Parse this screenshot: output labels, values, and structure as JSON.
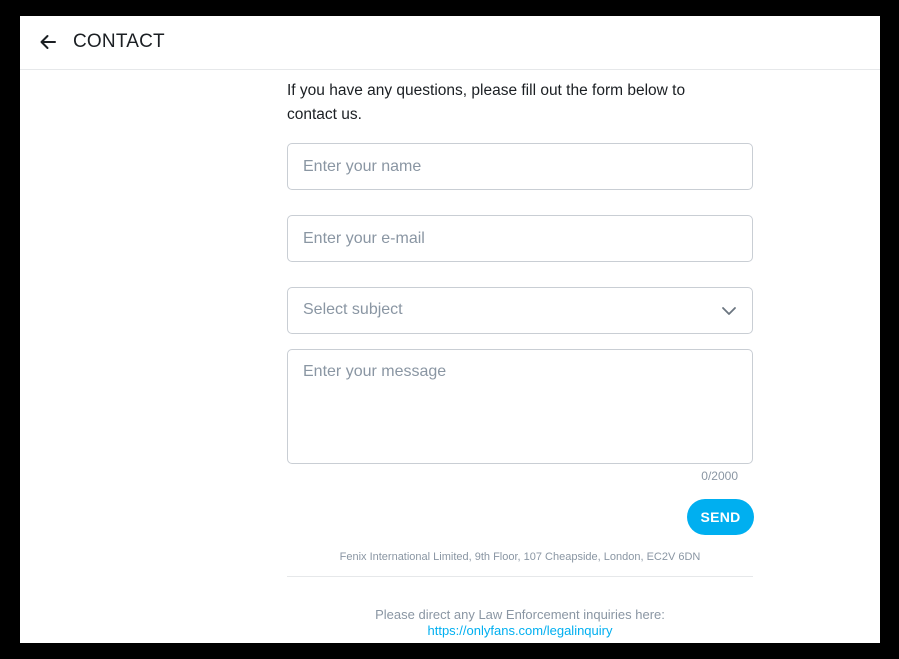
{
  "header": {
    "back_icon": "arrow-left-icon",
    "title": "CONTACT"
  },
  "intro": {
    "text": "If you have any questions, please fill out the form below to contact us."
  },
  "form": {
    "name_placeholder": "Enter your name",
    "email_placeholder": "Enter your e-mail",
    "subject_value": "Select subject",
    "subject_icon": "chevron-down-icon",
    "message_placeholder": "Enter your message",
    "message_counter": "0/2000",
    "send_label": "SEND"
  },
  "footer": {
    "address": "Fenix International Limited, 9th Floor, 107 Cheapside, London, EC2V 6DN",
    "law_text": "Please direct any Law Enforcement inquiries here:",
    "law_link": "https://onlyfans.com/legalinquiry"
  },
  "colors": {
    "accent": "#00aff0",
    "text": "#1b1f23",
    "muted": "#8a96a3",
    "border": "#c9ced4",
    "frame": "#000000"
  }
}
